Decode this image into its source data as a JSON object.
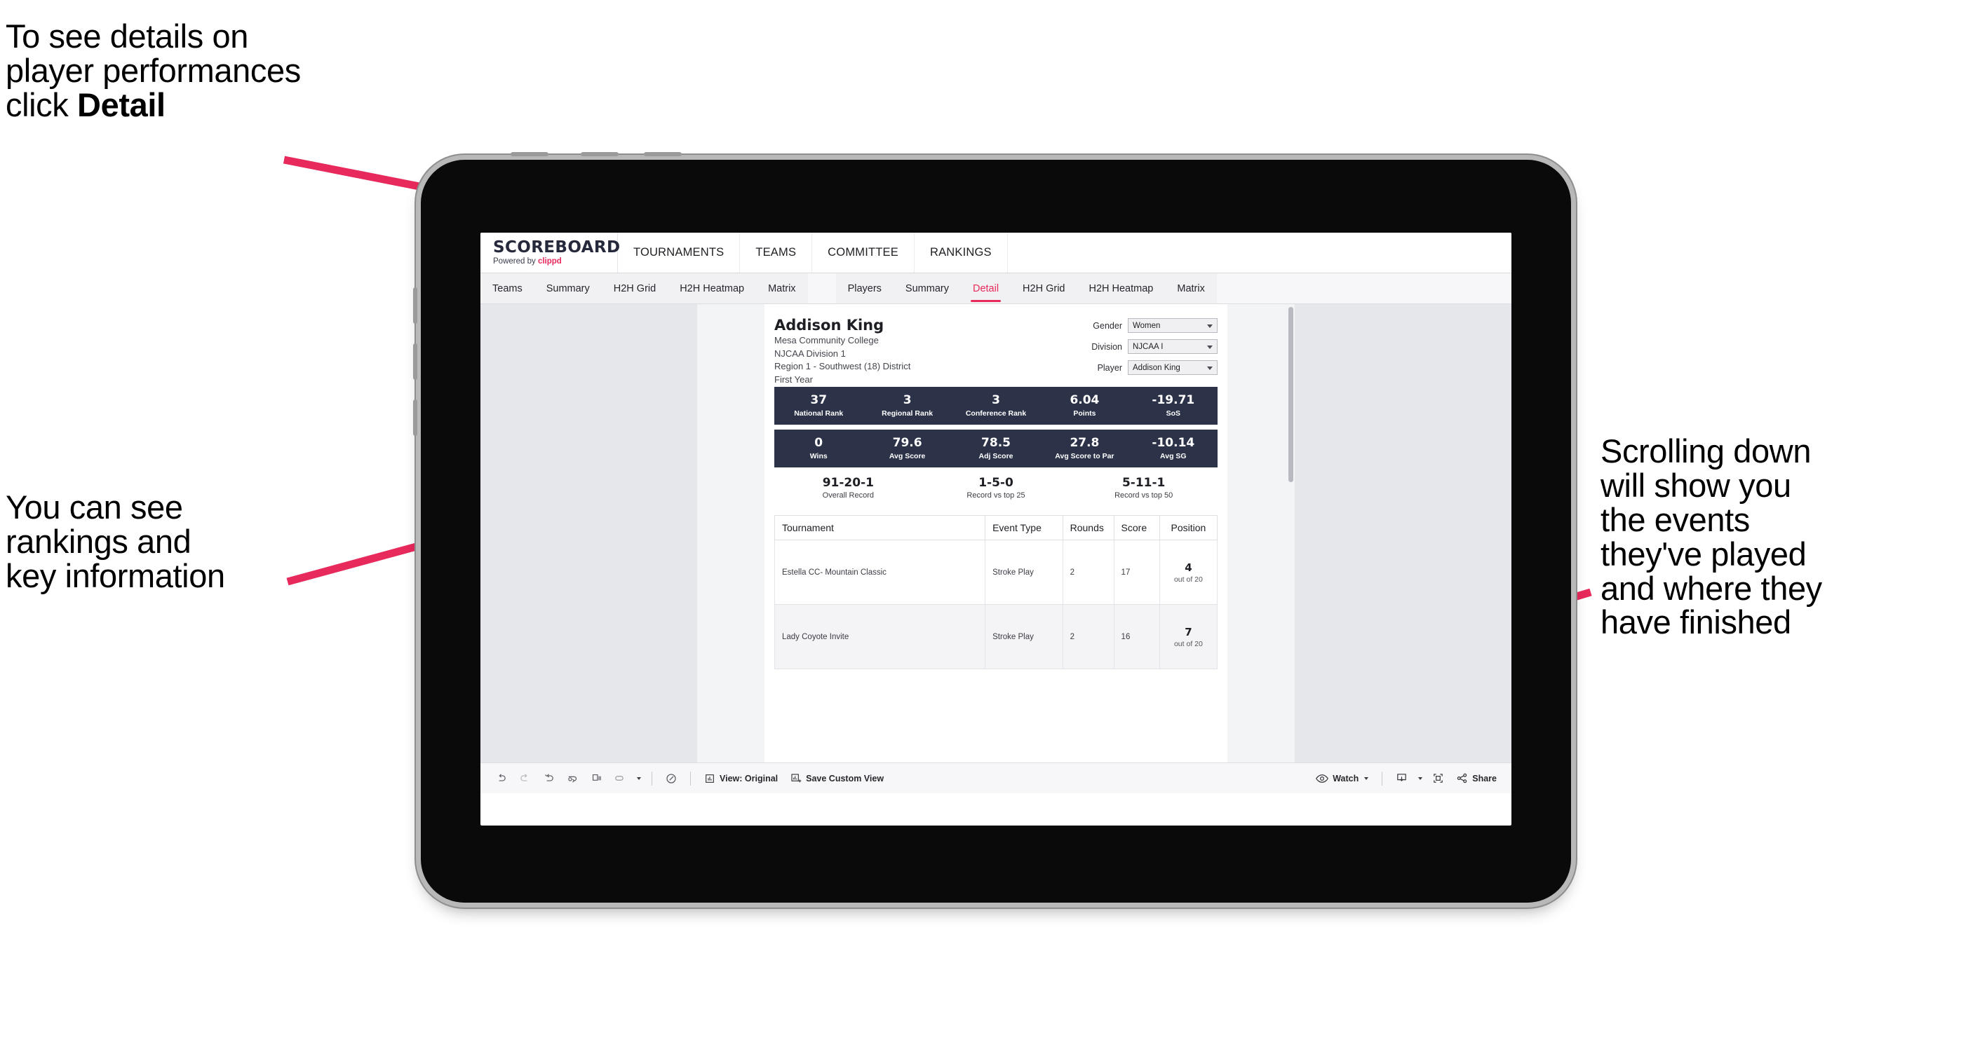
{
  "annotations": {
    "top_left": "To see details on\nplayer performances\nclick ",
    "top_left_bold": "Detail",
    "mid_left": "You can see\nrankings and\nkey information",
    "right": "Scrolling down\nwill show you\nthe events\nthey've played\nand where they\nhave finished"
  },
  "colors": {
    "accent_pink": "#E8295B",
    "stat_bar_navy": "#2C3349",
    "canvas_gray": "#E6E7EB"
  },
  "app": {
    "brand": {
      "title": "SCOREBOARD",
      "powered_by": "Powered by ",
      "clippd": "clippd"
    },
    "top_nav": [
      "TOURNAMENTS",
      "TEAMS",
      "COMMITTEE",
      "RANKINGS"
    ],
    "teams_tabs": [
      "Teams",
      "Summary",
      "H2H Grid",
      "H2H Heatmap",
      "Matrix"
    ],
    "players_tabs": [
      "Players",
      "Summary",
      "Detail",
      "H2H Grid",
      "H2H Heatmap",
      "Matrix"
    ],
    "active_tab": "Detail"
  },
  "player": {
    "name": "Addison King",
    "school": "Mesa Community College",
    "division": "NJCAA Division 1",
    "region": "Region 1 - Southwest (18) District",
    "year": "First Year"
  },
  "filters": [
    {
      "label": "Gender",
      "value": "Women"
    },
    {
      "label": "Division",
      "value": "NJCAA I"
    },
    {
      "label": "Player",
      "value": "Addison King"
    }
  ],
  "stats_row1": [
    {
      "value": "37",
      "label": "National Rank"
    },
    {
      "value": "3",
      "label": "Regional Rank"
    },
    {
      "value": "3",
      "label": "Conference Rank"
    },
    {
      "value": "6.04",
      "label": "Points"
    },
    {
      "value": "-19.71",
      "label": "SoS"
    }
  ],
  "stats_row2": [
    {
      "value": "0",
      "label": "Wins"
    },
    {
      "value": "79.6",
      "label": "Avg Score"
    },
    {
      "value": "78.5",
      "label": "Adj Score"
    },
    {
      "value": "27.8",
      "label": "Avg Score to Par"
    },
    {
      "value": "-10.14",
      "label": "Avg SG"
    }
  ],
  "records": [
    {
      "value": "91-20-1",
      "label": "Overall Record"
    },
    {
      "value": "1-5-0",
      "label": "Record vs top 25"
    },
    {
      "value": "5-11-1",
      "label": "Record vs top 50"
    }
  ],
  "table": {
    "headers": [
      "Tournament",
      "Event Type",
      "Rounds",
      "Score",
      "Position"
    ],
    "rows": [
      {
        "tournament": "Estella CC- Mountain Classic",
        "event_type": "Stroke Play",
        "rounds": "2",
        "score": "17",
        "position": "4",
        "position_of": "out of 20"
      },
      {
        "tournament": "Lady Coyote Invite",
        "event_type": "Stroke Play",
        "rounds": "2",
        "score": "16",
        "position": "7",
        "position_of": "out of 20"
      }
    ]
  },
  "toolbar": {
    "view_label": "View: Original",
    "save_label": "Save Custom View",
    "watch_label": "Watch",
    "share_label": "Share"
  }
}
